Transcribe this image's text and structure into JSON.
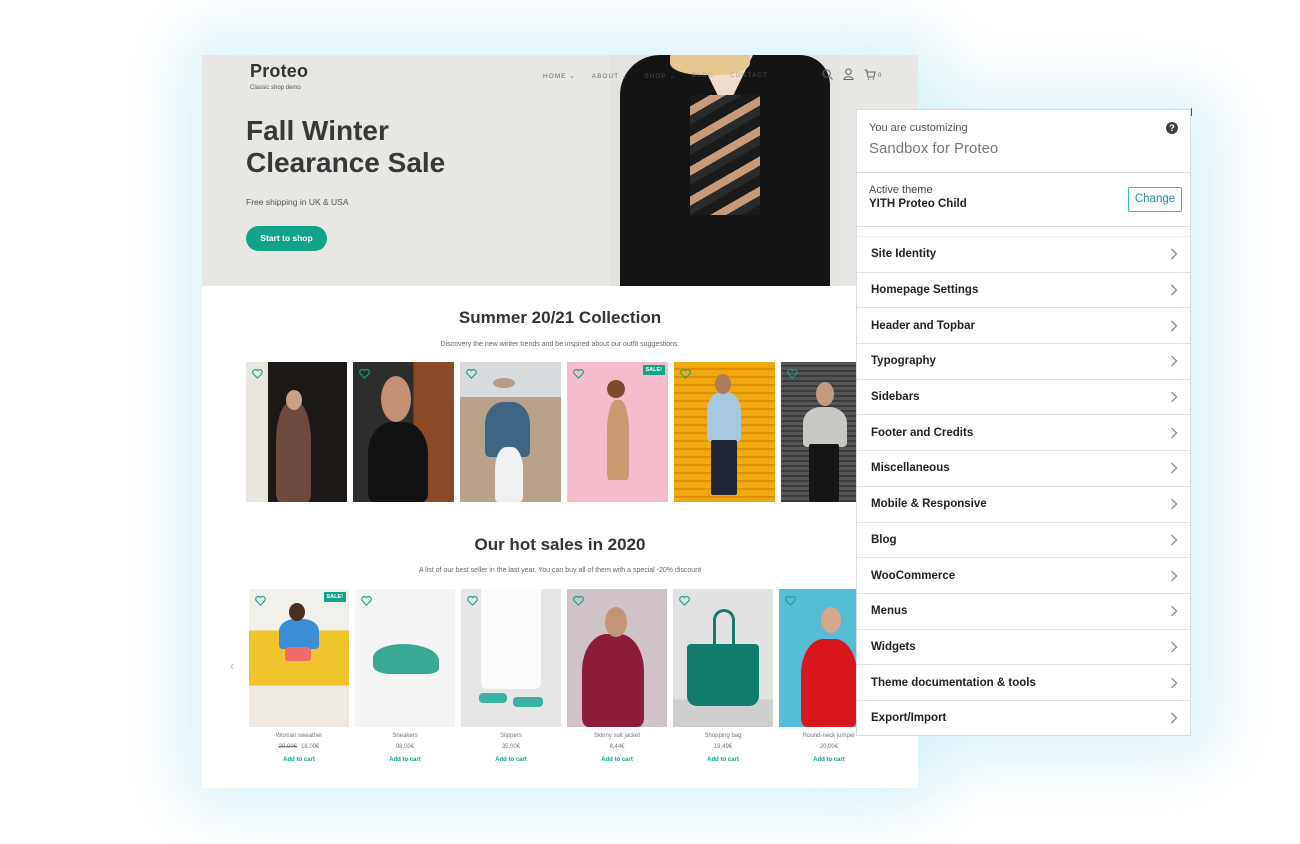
{
  "site": {
    "logo": "Proteo",
    "tagline": "Classic shop demo",
    "nav": [
      {
        "label": "HOME",
        "has_dropdown": true
      },
      {
        "label": "ABOUT",
        "has_dropdown": true
      },
      {
        "label": "SHOP",
        "has_dropdown": true
      },
      {
        "label": "BLOG",
        "has_dropdown": false
      },
      {
        "label": "CONTACT",
        "has_dropdown": false
      }
    ],
    "icons": [
      "search-icon",
      "user-icon",
      "cart-icon"
    ],
    "cart_count": "0",
    "hero": {
      "title_line1": "Fall Winter",
      "title_line2": "Clearance Sale",
      "subtitle": "Free shipping in UK & USA",
      "button": "Start to shop"
    },
    "collection": {
      "title": "Summer 20/21 Collection",
      "subtitle": "Discovery the new winter trends and be inspired about our outfit suggestions.",
      "items": [
        {
          "desc": "Man in brown jacket by brick arch",
          "sale": false
        },
        {
          "desc": "Woman with sunglasses in black top",
          "sale": false
        },
        {
          "desc": "Woman in hat and denim jacket",
          "sale": false
        },
        {
          "desc": "Woman jumping in beige dress on pink background",
          "sale": true
        },
        {
          "desc": "Man in light blue shirt on yellow shutter",
          "sale": false
        },
        {
          "desc": "Woman in grey sweater",
          "sale": false
        }
      ]
    },
    "hot_sales": {
      "title": "Our hot sales in 2020",
      "subtitle": "A list of our best seller in the last year. You can buy all of them with a special -20% discount",
      "products": [
        {
          "name": "Woman sweather",
          "old_price": "20,00€",
          "price": "18,00€",
          "sale": true,
          "cta": "Add to cart"
        },
        {
          "name": "Sneakers",
          "old_price": null,
          "price": "98,00€",
          "sale": false,
          "cta": "Add to cart"
        },
        {
          "name": "Slippers",
          "old_price": null,
          "price": "35,00€",
          "sale": false,
          "cta": "Add to cart"
        },
        {
          "name": "Skinny suit jacket",
          "old_price": null,
          "price": "8,44€",
          "sale": false,
          "cta": "Add to cart"
        },
        {
          "name": "Shopping bag",
          "old_price": null,
          "price": "19,49€",
          "sale": false,
          "cta": "Add to cart"
        },
        {
          "name": "Round-neck jumper",
          "old_price": null,
          "price": "20,00€",
          "sale": false,
          "cta": "Add to cart"
        }
      ]
    },
    "sale_badge": "SALE!",
    "accent_color": "#12a38a"
  },
  "customizer": {
    "customizing_label": "You are customizing",
    "site_name": "Sandbox for Proteo",
    "active_theme_label": "Active theme",
    "active_theme": "YITH Proteo Child",
    "change_button": "Change",
    "help_icon": "?",
    "sections": [
      "Site Identity",
      "Homepage Settings",
      "Header and Topbar",
      "Typography",
      "Sidebars",
      "Footer and Credits",
      "Miscellaneous",
      "Mobile & Responsive",
      "Blog",
      "WooCommerce",
      "Menus",
      "Widgets",
      "Theme documentation & tools",
      "Export/Import"
    ],
    "accent_color": "#46b5b0"
  }
}
